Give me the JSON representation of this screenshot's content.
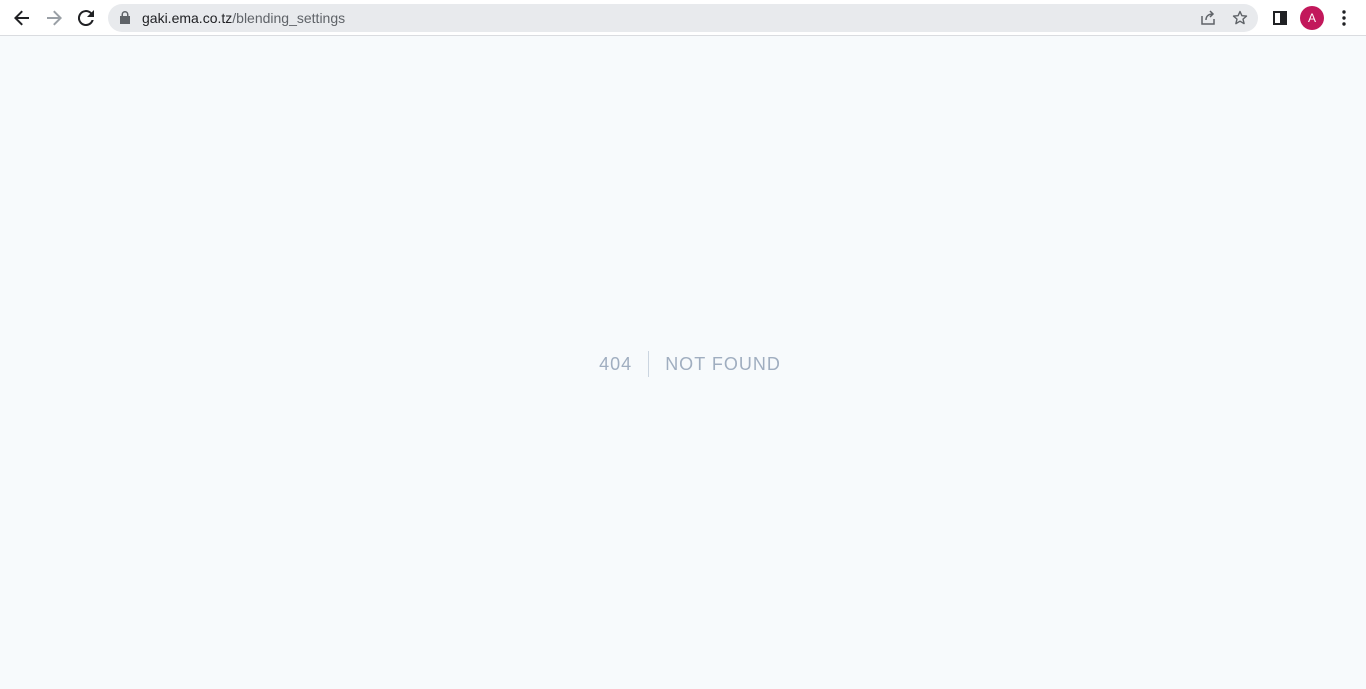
{
  "browser": {
    "url_host": "gaki.ema.co.tz",
    "url_path": "/blending_settings",
    "profile_initial": "A",
    "profile_color": "#c2185b",
    "icons": {
      "back": "back-arrow-icon",
      "forward": "forward-arrow-icon",
      "reload": "reload-icon",
      "lock": "lock-icon",
      "share": "share-icon",
      "bookmark": "star-icon",
      "side_panel": "side-panel-icon",
      "menu": "kebab-menu-icon"
    }
  },
  "page": {
    "error_code": "404",
    "error_message": "NOT FOUND",
    "background": "#f7fafc",
    "text_color": "#a0aec0"
  }
}
